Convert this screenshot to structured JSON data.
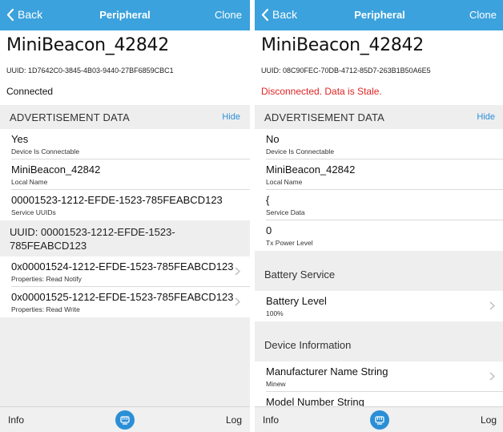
{
  "colors": {
    "nav_bar": "#3ba2dd",
    "link": "#2a8fd6",
    "stale_text": "#e02424",
    "group_bg": "#eeeeef"
  },
  "screens": [
    {
      "nav": {
        "back": "Back",
        "title": "Peripheral",
        "clone": "Clone"
      },
      "device_name": "MiniBeacon_42842",
      "uuid": "UUID: 1D7642C0-3845-4B03-9440-27BF6859CBC1",
      "status": "Connected",
      "adv": {
        "title": "ADVERTISEMENT DATA",
        "action": "Hide",
        "rows": [
          {
            "value": "Yes",
            "label": "Device Is Connectable"
          },
          {
            "value": "MiniBeacon_42842",
            "label": "Local Name"
          },
          {
            "value": "00001523-1212-EFDE-1523-785FEABCD123",
            "label": "Service UUIDs"
          }
        ]
      },
      "service": {
        "title": "UUID: 00001523-1212-EFDE-1523-785FEABCD123",
        "characteristics": [
          {
            "uuid": "0x00001524-1212-EFDE-1523-785FEABCD123",
            "props": "Properties: Read Notify"
          },
          {
            "uuid": "0x00001525-1212-EFDE-1523-785FEABCD123",
            "props": "Properties: Read Write"
          }
        ]
      },
      "tabbar": {
        "left": "Info",
        "right": "Log",
        "center_icon": "fist-logo-icon"
      }
    },
    {
      "nav": {
        "back": "Back",
        "title": "Peripheral",
        "clone": "Clone"
      },
      "device_name": "MiniBeacon_42842",
      "uuid": "UUID: 08C90FEC-70DB-4712-85D7-263B1B50A6E5",
      "status": "Disconnected. Data is Stale.",
      "adv": {
        "title": "ADVERTISEMENT DATA",
        "action": "Hide",
        "rows": [
          {
            "value": "No",
            "label": "Device Is Connectable"
          },
          {
            "value": "MiniBeacon_42842",
            "label": "Local Name"
          },
          {
            "value": "{",
            "label": "Service Data"
          },
          {
            "value": "0",
            "label": "Tx Power Level"
          }
        ]
      },
      "battery": {
        "title": "Battery Service",
        "row": {
          "value": "Battery Level",
          "label": "100%"
        }
      },
      "device_info": {
        "title": "Device Information",
        "rows": [
          {
            "value": "Manufacturer Name String",
            "label": "Minew"
          },
          {
            "value": "Model Number String",
            "label": ""
          }
        ]
      },
      "tabbar": {
        "left": "Info",
        "right": "Log",
        "center_icon": "fist-logo-icon"
      }
    }
  ]
}
